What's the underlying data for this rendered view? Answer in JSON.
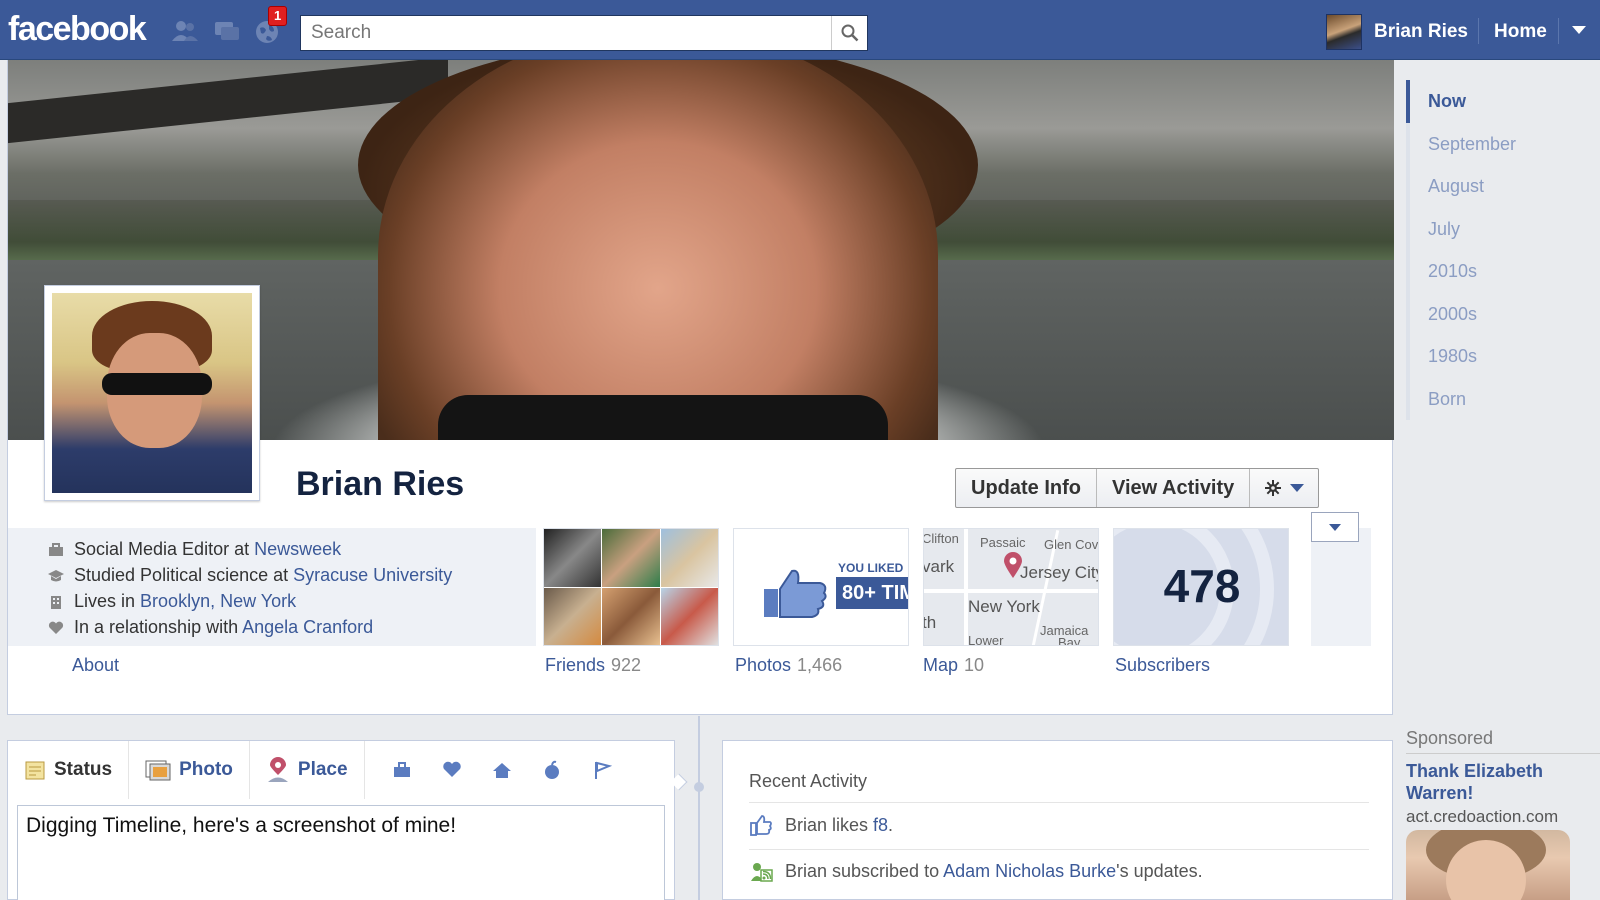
{
  "topbar": {
    "logo": "facebook",
    "notification_count": "1",
    "search_placeholder": "Search",
    "user_name": "Brian Ries",
    "home_label": "Home"
  },
  "profile": {
    "name": "Brian Ries",
    "actions": {
      "update_info": "Update Info",
      "view_activity": "View Activity"
    }
  },
  "about": {
    "lines": [
      {
        "prefix": "Social Media Editor at",
        "links": [
          "Newsweek"
        ]
      },
      {
        "prefix": "Studied Political science at",
        "links": [
          "Syracuse University"
        ]
      },
      {
        "prefix": "Lives in",
        "links": [
          "Brooklyn, New York"
        ]
      },
      {
        "prefix": "In a relationship with",
        "links": [
          "Angela Cranford"
        ]
      }
    ],
    "about_link": "About"
  },
  "apps": {
    "friends": {
      "label": "Friends",
      "count": "922"
    },
    "photos": {
      "label": "Photos",
      "count": "1,466",
      "liked_small": "YOU LIKED",
      "liked_big": "80+ TIM"
    },
    "map": {
      "label": "Map",
      "count": "10",
      "places": [
        "Clifton",
        "Passaic",
        "Glen Cov",
        "vark",
        "Jersey City",
        "New York",
        "th",
        "Jamaica",
        "Lower",
        "Bay"
      ]
    },
    "subscribers": {
      "label": "Subscribers",
      "count": "478"
    }
  },
  "timeline_nav": [
    "Now",
    "September",
    "August",
    "July",
    "2010s",
    "2000s",
    "1980s",
    "Born"
  ],
  "sponsored": {
    "label": "Sponsored",
    "title": "Thank Elizabeth Warren!",
    "domain": "act.credoaction.com"
  },
  "composer": {
    "tabs": [
      "Status",
      "Photo",
      "Place"
    ],
    "icons": [
      "work-icon",
      "heart-icon",
      "home-icon",
      "apple-icon",
      "flag-icon"
    ],
    "text": "Digging Timeline, here's a screenshot of mine!"
  },
  "activity": {
    "title": "Recent Activity",
    "item1": {
      "text": "Brian likes ",
      "link": "f8",
      "suffix": "."
    },
    "item2": {
      "text": "Brian subscribed to ",
      "link": "Adam Nicholas Burke",
      "suffix": "'s updates."
    }
  },
  "colors": {
    "brand": "#3b5998",
    "topbar": "#3b5998",
    "link": "#3b5998",
    "badge": "#e02020"
  }
}
